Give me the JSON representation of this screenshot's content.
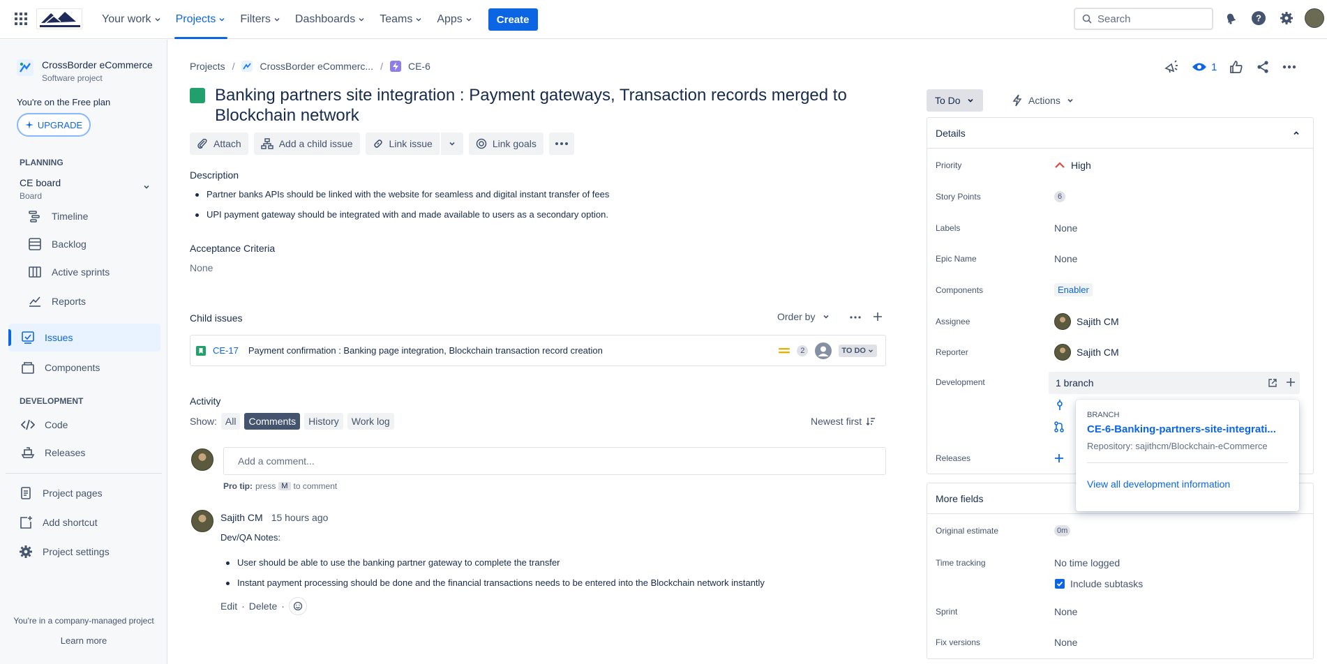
{
  "topnav": {
    "items": [
      "Your work",
      "Projects",
      "Filters",
      "Dashboards",
      "Teams",
      "Apps"
    ],
    "create_label": "Create",
    "search_placeholder": "Search"
  },
  "sidebar": {
    "project_name": "CrossBorder eCommerce",
    "project_type": "Software project",
    "free_plan": "You're on the Free plan",
    "upgrade_label": "UPGRADE",
    "planning_heading": "PLANNING",
    "board_name": "CE board",
    "board_type": "Board",
    "planning_items": [
      "Timeline",
      "Backlog",
      "Active sprints",
      "Reports"
    ],
    "issues_label": "Issues",
    "components_label": "Components",
    "development_heading": "DEVELOPMENT",
    "dev_items": [
      "Code",
      "Releases"
    ],
    "bottom_items": [
      "Project pages",
      "Add shortcut",
      "Project settings"
    ],
    "managed_text": "You're in a company-managed project",
    "learn_more": "Learn more"
  },
  "breadcrumb": {
    "projects": "Projects",
    "project": "CrossBorder eCommerc...",
    "issue": "CE-6"
  },
  "issue": {
    "title": "Banking partners site integration : Payment gateways, Transaction records merged to Blockchain network",
    "watchers": "1",
    "toolbar": {
      "attach": "Attach",
      "add_child": "Add a child issue",
      "link_issue": "Link issue",
      "link_goals": "Link goals"
    },
    "description_label": "Description",
    "description_items": [
      "Partner banks APIs should be linked with the website for seamless and digital instant transfer of fees",
      "UPI payment gateway should be integrated with and made available to users as a secondary option."
    ],
    "acceptance_label": "Acceptance Criteria",
    "acceptance_value": "None",
    "child_issues_label": "Child issues",
    "order_by": "Order by",
    "child": {
      "key": "CE-17",
      "summary": "Payment confirmation : Banking page integration, Blockchain transaction record creation",
      "points": "2",
      "status": "TO DO"
    }
  },
  "activity": {
    "label": "Activity",
    "show_label": "Show:",
    "filters": [
      "All",
      "Comments",
      "History",
      "Work log"
    ],
    "active_filter": "Comments",
    "sort": "Newest first",
    "comment_placeholder": "Add a comment...",
    "protip_prefix": "Pro tip:",
    "protip_press": "press",
    "protip_key": "M",
    "protip_suffix": "to comment",
    "comment": {
      "author": "Sajith CM",
      "time": "15 hours ago",
      "heading": "Dev/QA Notes:",
      "items": [
        "User should be able to use the banking partner gateway to complete the transfer",
        "Instant payment processing should be done and the financial transactions needs to be entered into the Blockchain network instantly"
      ],
      "edit": "Edit",
      "delete": "Delete"
    }
  },
  "right": {
    "status": "To Do",
    "actions": "Actions",
    "details_title": "Details",
    "fields": {
      "priority_k": "Priority",
      "priority_v": "High",
      "story_k": "Story Points",
      "story_v": "6",
      "labels_k": "Labels",
      "labels_v": "None",
      "epic_k": "Epic Name",
      "epic_v": "None",
      "components_k": "Components",
      "components_v": "Enabler",
      "assignee_k": "Assignee",
      "assignee_v": "Sajith CM",
      "reporter_k": "Reporter",
      "reporter_v": "Sajith CM",
      "development_k": "Development",
      "development_v": "1 branch",
      "releases_k": "Releases"
    },
    "more_fields_title": "More fields",
    "more": {
      "orig_k": "Original estimate",
      "orig_v": "0m",
      "time_k": "Time tracking",
      "time_v": "No time logged",
      "subtasks": "Include subtasks",
      "sprint_k": "Sprint",
      "sprint_v": "None",
      "fix_k": "Fix versions",
      "fix_v": "None"
    },
    "popover": {
      "caption": "BRANCH",
      "branch": "CE-6-Banking-partners-site-integrati...",
      "repo": "Repository: sajithcm/Blockchain-eCommerce",
      "link": "View all development information"
    }
  }
}
